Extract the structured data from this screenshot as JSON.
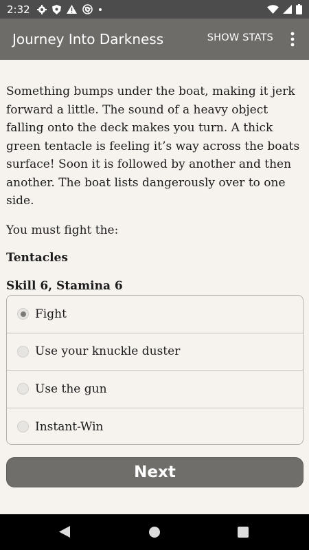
{
  "status_bar": {
    "time": "2:32",
    "left_icons": [
      "gear-icon",
      "shield-icon",
      "warning-icon",
      "aperture-icon",
      "dot-icon"
    ],
    "right_icons": [
      "wifi-icon",
      "signal-icon",
      "battery-icon"
    ]
  },
  "app_bar": {
    "title": "Journey Into Darkness",
    "show_stats_label": "SHOW STATS",
    "overflow_icon": "more-vert-icon"
  },
  "content": {
    "story": "Something bumps under the boat, making it jerk forward a little. The sound of a heavy object falling onto the deck makes you turn. A thick green tentacle is feeling it’s way across the boats surface! Soon it is followed by another and then another. The boat lists dangerously over to one side.",
    "must_fight": "You must fight the:",
    "enemy_name": "Tentacles",
    "enemy_stats": "Skill 6, Stamina 6"
  },
  "options": [
    {
      "label": "Fight",
      "selected": true
    },
    {
      "label": "Use your knuckle duster",
      "selected": false
    },
    {
      "label": "Use the gun",
      "selected": false
    },
    {
      "label": "Instant-Win",
      "selected": false
    }
  ],
  "next_label": "Next",
  "nav_bar": {
    "icons": [
      "back-icon",
      "home-icon",
      "recents-icon"
    ]
  },
  "colors": {
    "app_bar": "#6d6c69",
    "status_bar": "#4c4c4c",
    "background": "#f6f3ef",
    "button": "#6f6e6b"
  }
}
